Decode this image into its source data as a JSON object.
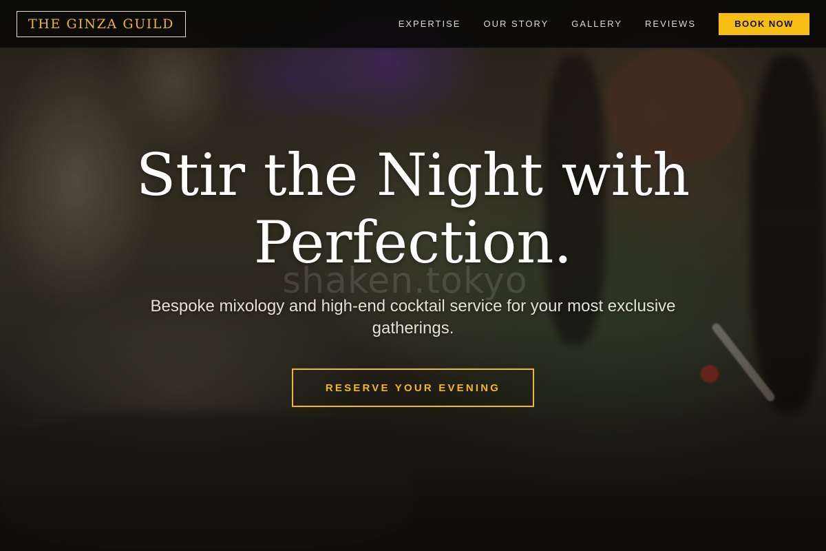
{
  "brand": {
    "logo_text": "THE GINZA GUILD"
  },
  "nav": {
    "links": [
      {
        "label": "EXPERTISE"
      },
      {
        "label": "OUR STORY"
      },
      {
        "label": "GALLERY"
      },
      {
        "label": "REVIEWS"
      }
    ],
    "book_label": "BOOK NOW"
  },
  "hero": {
    "title_line1": "Stir the Night with",
    "title_line2": "Perfection.",
    "subtitle": "Bespoke mixology and high-end cocktail service for your most exclusive gatherings.",
    "cta_label": "RESERVE YOUR EVENING",
    "watermark": "shaken.tokyo"
  },
  "colors": {
    "accent": "#f6bd14",
    "logo_text": "#e9b62d",
    "nav_background": "#080808",
    "heading": "#ffffff"
  },
  "icons": {
    "hero_image": "bartender-photo"
  }
}
